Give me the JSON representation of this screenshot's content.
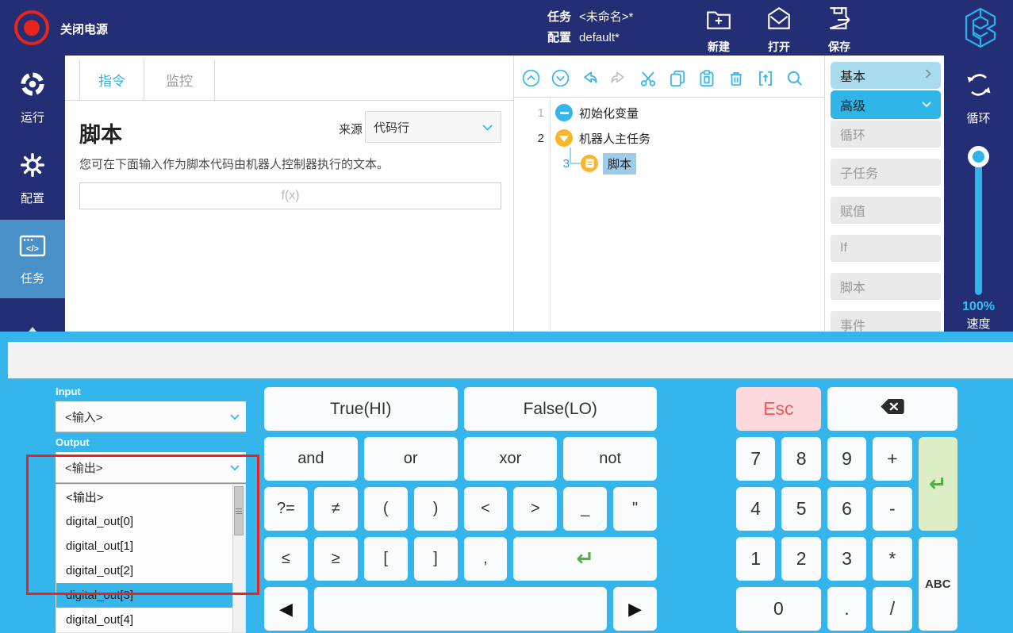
{
  "topbar": {
    "power_label": "关闭电源",
    "task_label": "任务",
    "task_value": "<未命名>*",
    "config_label": "配置",
    "config_value": "default*",
    "new_label": "新建",
    "open_label": "打开",
    "save_label": "保存"
  },
  "sidebar": {
    "run_label": "运行",
    "config_label": "配置",
    "task_label": "任务"
  },
  "main": {
    "tab_instruction": "指令",
    "tab_monitor": "监控",
    "title": "脚本",
    "source_label": "来源",
    "source_value": "代码行",
    "description": "您可在下面输入作为脚本代码由机器人控制器执行的文本。",
    "expression_placeholder": "f(x)"
  },
  "tree": {
    "rows": [
      {
        "num": "1",
        "label": "初始化变量"
      },
      {
        "num": "2",
        "label": "机器人主任务"
      },
      {
        "num": "3",
        "label": "脚本"
      }
    ]
  },
  "commands": {
    "basic_label": "基本",
    "advanced_label": "高级",
    "items": [
      "循环",
      "子任务",
      "赋值",
      "If",
      "脚本",
      "事件"
    ]
  },
  "rail": {
    "loop_label": "循环",
    "speed_value": "100%",
    "speed_label": "速度"
  },
  "keyboard": {
    "display_value": "",
    "input_label": "Input",
    "input_value": "<输入>",
    "output_label": "Output",
    "output_value": "<输出>",
    "output_options": [
      "<输出>",
      "digital_out[0]",
      "digital_out[1]",
      "digital_out[2]",
      "digital_out[3]",
      "digital_out[4]"
    ],
    "highlighted_option": "digital_out[3]",
    "keys": {
      "true_hi": "True(HI)",
      "false_lo": "False(LO)",
      "and": "and",
      "or": "or",
      "xor": "xor",
      "not": "not",
      "assign": "?=",
      "neq": "≠",
      "lparen": "(",
      "rparen": ")",
      "lt": "<",
      "gt": ">",
      "underscore": "_",
      "quote": "\"",
      "le": "≤",
      "ge": "≥",
      "lbracket": "[",
      "rbracket": "]",
      "comma": ",",
      "enter": "↵",
      "nav_left": "◀",
      "nav_right": "▶",
      "esc": "Esc",
      "d7": "7",
      "d8": "8",
      "d9": "9",
      "plus": "+",
      "d4": "4",
      "d5": "5",
      "d6": "6",
      "minus": "-",
      "d1": "1",
      "d2": "2",
      "d3": "3",
      "star": "*",
      "abc": "ABC",
      "d0": "0",
      "dot": ".",
      "slash": "/"
    }
  },
  "colors": {
    "navy": "#242e75",
    "accent_cyan": "#2fb3e8",
    "keyboard_bg": "#34b6ed",
    "selected_sidebar": "#4a90c8",
    "node_yellow": "#f8b62d",
    "annotation_red": "#e8251d"
  }
}
